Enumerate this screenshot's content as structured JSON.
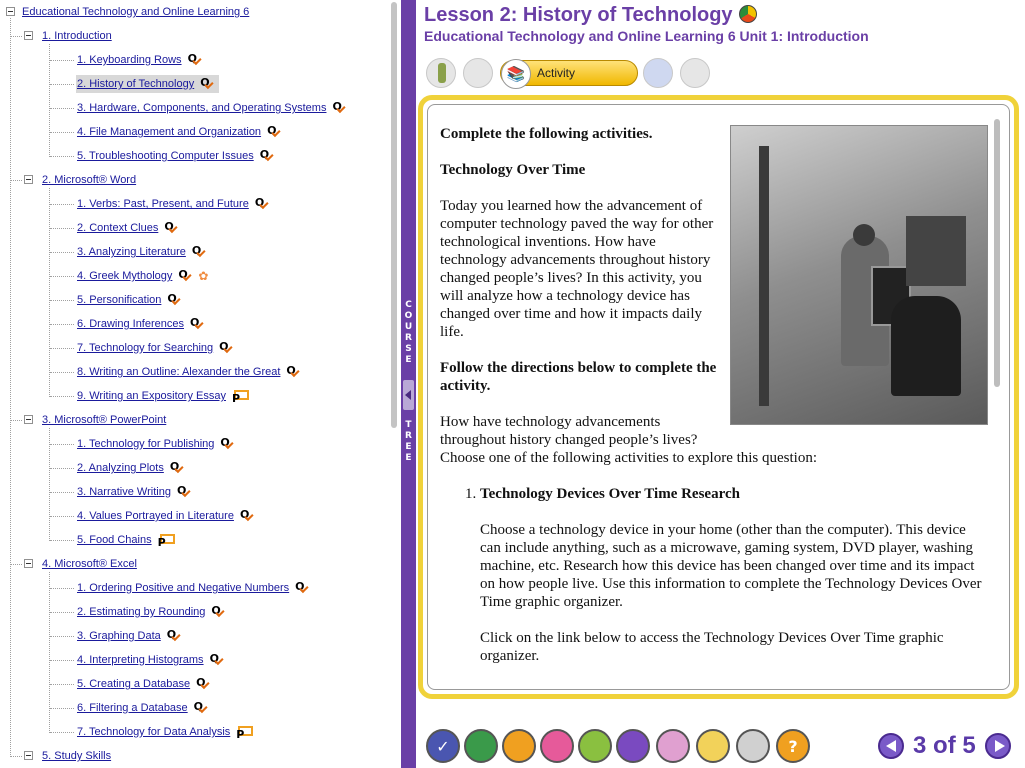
{
  "course_tree": {
    "root": "Educational Technology and Online Learning 6",
    "units": [
      {
        "label": "1. Introduction",
        "lessons": [
          {
            "label": "1. Keyboarding Rows",
            "icon": "quiz-check-icon"
          },
          {
            "label": "2. History of Technology",
            "icon": "quiz-check-icon",
            "selected": true
          },
          {
            "label": "3. Hardware, Components, and Operating Systems",
            "icon": "quiz-check-icon"
          },
          {
            "label": "4. File Management and Organization",
            "icon": "quiz-check-icon"
          },
          {
            "label": "5. Troubleshooting Computer Issues",
            "icon": "quiz-check-icon"
          }
        ]
      },
      {
        "label": "2. Microsoft® Word",
        "lessons": [
          {
            "label": "1. Verbs: Past, Present, and Future",
            "icon": "quiz-check-icon"
          },
          {
            "label": "2. Context Clues",
            "icon": "quiz-check-icon"
          },
          {
            "label": "3. Analyzing Literature",
            "icon": "quiz-check-icon"
          },
          {
            "label": "4. Greek Mythology",
            "icon": "quiz-check-flower-icon"
          },
          {
            "label": "5. Personification",
            "icon": "quiz-check-icon"
          },
          {
            "label": "6. Drawing Inferences",
            "icon": "quiz-check-icon"
          },
          {
            "label": "7. Technology for Searching",
            "icon": "quiz-check-icon"
          },
          {
            "label": "8. Writing an Outline: Alexander the Great",
            "icon": "quiz-check-icon"
          },
          {
            "label": "9. Writing an Expository Essay",
            "icon": "project-icon"
          }
        ]
      },
      {
        "label": "3. Microsoft® PowerPoint",
        "lessons": [
          {
            "label": "1. Technology for Publishing",
            "icon": "quiz-check-icon"
          },
          {
            "label": "2. Analyzing Plots",
            "icon": "quiz-check-icon"
          },
          {
            "label": "3. Narrative Writing",
            "icon": "quiz-check-icon"
          },
          {
            "label": "4. Values Portrayed in Literature",
            "icon": "quiz-check-icon"
          },
          {
            "label": "5. Food Chains",
            "icon": "project-icon"
          }
        ]
      },
      {
        "label": "4. Microsoft® Excel",
        "lessons": [
          {
            "label": "1. Ordering Positive and Negative Numbers",
            "icon": "quiz-check-icon"
          },
          {
            "label": "2. Estimating by Rounding",
            "icon": "quiz-check-icon"
          },
          {
            "label": "3. Graphing Data",
            "icon": "quiz-check-icon"
          },
          {
            "label": "4. Interpreting Histograms",
            "icon": "quiz-check-icon"
          },
          {
            "label": "5. Creating a Database",
            "icon": "quiz-check-icon"
          },
          {
            "label": "6. Filtering a Database",
            "icon": "quiz-check-icon"
          },
          {
            "label": "7. Technology for Data Analysis",
            "icon": "project-icon"
          }
        ]
      },
      {
        "label": "5. Study Skills",
        "lessons": []
      }
    ],
    "quiz_glyph": "Q",
    "project_glyph": "P",
    "flower_glyph": "✿"
  },
  "divider": {
    "top": "COURSE",
    "bottom": "TREE"
  },
  "header": {
    "title": "Lesson 2: History of Technology",
    "subtitle": "Educational Technology and Online Learning 6  Unit 1: Introduction"
  },
  "toolbar": {
    "activity_label": "Activity"
  },
  "content": {
    "heading1": "Complete the following activities.",
    "heading2": "Technology Over Time",
    "para1": "Today you learned how the advancement of computer technology paved the way for other technological inventions. How have technology advancements throughout history changed people’s lives? In this activity, you will analyze how a technology device has changed over time and how it impacts daily life.",
    "heading3": "Follow the directions below to complete the activity.",
    "para2": "How have technology advancements throughout history changed people’s lives? Choose one of the following activities to explore this question:",
    "list1_title": "Technology Devices Over Time Research",
    "list1_para1": "Choose a technology device in your home (other than the computer). This device can include anything, such as a microwave, gaming system, DVD player, washing machine, etc. Research how this device has been changed over time and its impact on how people live. Use this information to complete the Technology Devices Over Time graphic organizer.",
    "list1_para2": "Click on the link below to access the Technology Devices Over Time graphic organizer."
  },
  "bottom_bar": {
    "icons": [
      "check-icon",
      "book-icon",
      "backpack-icon",
      "pushpin-icon",
      "grid-icon",
      "target-icon",
      "monitor-icon",
      "printer-icon",
      "scanner-icon",
      "help-icon"
    ],
    "help_glyph": "?",
    "page_current": "3",
    "page_of": "of",
    "page_total": "5"
  },
  "colors": {
    "brand_purple": "#6a3fa6",
    "frame_yellow": "#f0d23a",
    "link_blue": "#1a1a9c",
    "check_orange": "#e06a10"
  }
}
